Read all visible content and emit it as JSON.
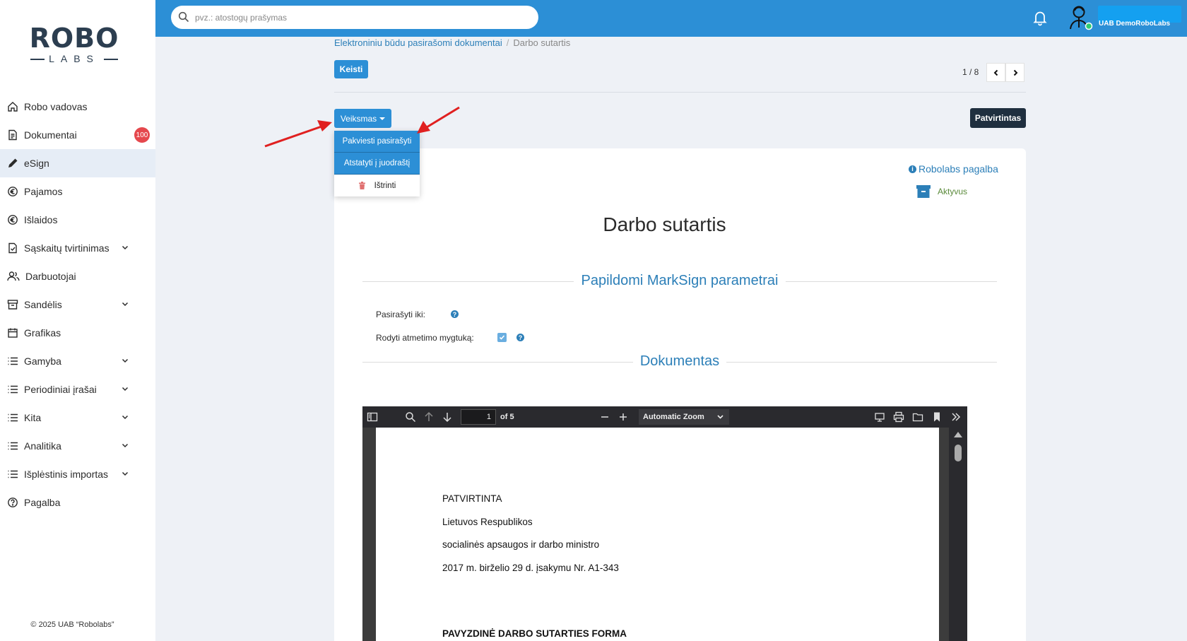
{
  "sidebar": {
    "logo_top": "ROBO",
    "logo_bottom": "LABS",
    "items": [
      {
        "label": "Robo vadovas",
        "icon": "home-icon"
      },
      {
        "label": "Dokumentai",
        "icon": "document-icon",
        "badge": "100"
      },
      {
        "label": "eSign",
        "icon": "pen-icon"
      },
      {
        "label": "Pajamos",
        "icon": "income-icon"
      },
      {
        "label": "Išlaidos",
        "icon": "expense-icon"
      },
      {
        "label": "Sąskaitų tvirtinimas",
        "icon": "invoice-check-icon"
      },
      {
        "label": "Darbuotojai",
        "icon": "users-icon"
      },
      {
        "label": "Sandėlis",
        "icon": "warehouse-icon"
      },
      {
        "label": "Grafikas",
        "icon": "calendar-icon"
      },
      {
        "label": "Gamyba",
        "icon": "list-icon"
      },
      {
        "label": "Periodiniai įrašai",
        "icon": "list-icon"
      },
      {
        "label": "Kita",
        "icon": "list-icon"
      },
      {
        "label": "Analitika",
        "icon": "list-icon"
      },
      {
        "label": "Išplėstinis importas",
        "icon": "list-icon"
      },
      {
        "label": "Pagalba",
        "icon": "help-icon"
      }
    ],
    "copyright": "© 2025 UAB “Robolabs”"
  },
  "topbar": {
    "search_placeholder": "pvz.: atostogų prašymas",
    "user_name": "UAB DemoRoboLabs"
  },
  "breadcrumb": {
    "parent": "Elektroniniu būdu pasirašomi dokumentai",
    "current": "Darbo sutartis"
  },
  "header": {
    "edit_label": "Keisti",
    "pager_text": "1 / 8",
    "action_label": "Veiksmas",
    "status_label": "Patvirtintas"
  },
  "dropdown": {
    "items": [
      "Pakviesti pasirašyti",
      "Atstatyti į juodraštį",
      "Ištrinti"
    ]
  },
  "card": {
    "help_link": "Robolabs pagalba",
    "state_label": "Aktyvus",
    "title": "Darbo sutartis",
    "section_params": "Papildomi MarkSign parametrai",
    "field_sign_until": "Pasirašyti iki:",
    "field_show_reject": "Rodyti atmetimo mygtuką:",
    "section_document": "Dokumentas"
  },
  "pdf": {
    "page_number": "1",
    "page_count_label": "of 5",
    "zoom": "Automatic Zoom",
    "lines": [
      "PATVIRTINTA",
      "Lietuvos Respublikos",
      "socialinės apsaugos ir darbo ministro",
      "2017 m. birželio 29 d. įsakymu Nr. A1-343",
      "PAVYZDINĖ DARBO SUTARTIES FORMA"
    ]
  },
  "colors": {
    "accent": "#2c8fd6",
    "dark": "#1f2f3f",
    "badge": "#e5484d",
    "arrow": "#e02020"
  }
}
